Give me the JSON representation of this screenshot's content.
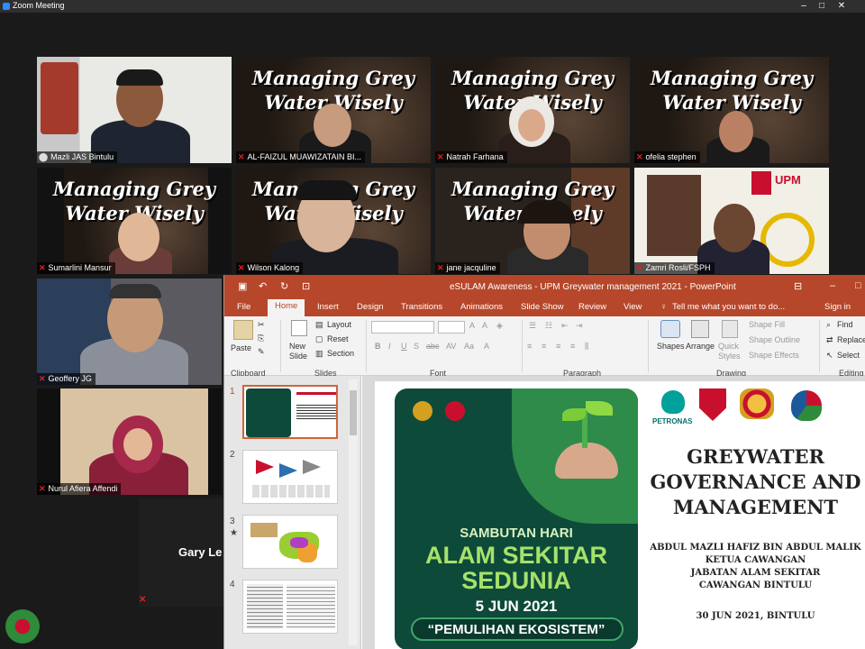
{
  "window": {
    "title": "Zoom Meeting"
  },
  "participants": [
    {
      "name": "Mazli JAS Bintulu",
      "muted": false
    },
    {
      "name": "AL-FAIZUL MUAWIZATAIN BI...",
      "muted": true
    },
    {
      "name": "Natrah Farhana",
      "muted": true
    },
    {
      "name": "ofelia stephen",
      "muted": true
    },
    {
      "name": "Sumarlini Mansur",
      "muted": true
    },
    {
      "name": "Wilson Kalong",
      "muted": true
    },
    {
      "name": "jane jacquline",
      "muted": true
    },
    {
      "name": "Zamri Rosli/FSPH",
      "muted": true
    },
    {
      "name": "Geoffery JG",
      "muted": true
    },
    {
      "name": "Nurul Afiera Affendi",
      "muted": true
    },
    {
      "name": "Gary Le",
      "muted": true
    }
  ],
  "background_text": "Managing Grey Water Wisely",
  "ppt": {
    "title": "eSULAM Awareness - UPM Greywater management 2021  -  PowerPoint",
    "tabs": [
      "File",
      "Home",
      "Insert",
      "Design",
      "Transitions",
      "Animations",
      "Slide Show",
      "Review",
      "View"
    ],
    "tell_me": "Tell me what you want to do...",
    "sign_in": "Sign in",
    "ribbon": {
      "paste": "Paste",
      "new_slide": "New Slide",
      "layout": "Layout",
      "reset": "Reset",
      "section": "Section",
      "shapes": "Shapes",
      "arrange": "Arrange",
      "quick_styles": "Quick Styles",
      "shape_fill": "Shape Fill",
      "shape_outline": "Shape Outline",
      "shape_effects": "Shape Effects",
      "find": "Find",
      "replace": "Replace",
      "select": "Select",
      "groups": {
        "clipboard": "Clipboard",
        "slides": "Slides",
        "font": "Font",
        "paragraph": "Paragraph",
        "drawing": "Drawing",
        "editing": "Editing"
      }
    },
    "thumbs": [
      "1",
      "2",
      "3",
      "4"
    ],
    "slide": {
      "poster_line1": "SAMBUTAN HARI",
      "poster_line2": "ALAM SEKITAR",
      "poster_line3": "SEDUNIA",
      "poster_date": "5 JUN 2021",
      "poster_theme": "“PEMULIHAN EKOSISTEM”",
      "petronas": "PETRONAS",
      "upm": "UPM",
      "title_l1": "GREYWATER",
      "title_l2": "GOVERNANCE AND",
      "title_l3": "MANAGEMENT",
      "auth_l1": "ABDUL MAZLI HAFIZ BIN ABDUL MALIK",
      "auth_l2": "KETUA CAWANGAN",
      "auth_l3": "JABATAN ALAM SEKITAR",
      "auth_l4": "CAWANGAN BINTULU",
      "date": "30 JUN 2021, BINTULU"
    }
  },
  "colors": {
    "ppt_accent": "#b7472a",
    "poster_green": "#0e4a3a",
    "mute_red": "#e02020"
  }
}
